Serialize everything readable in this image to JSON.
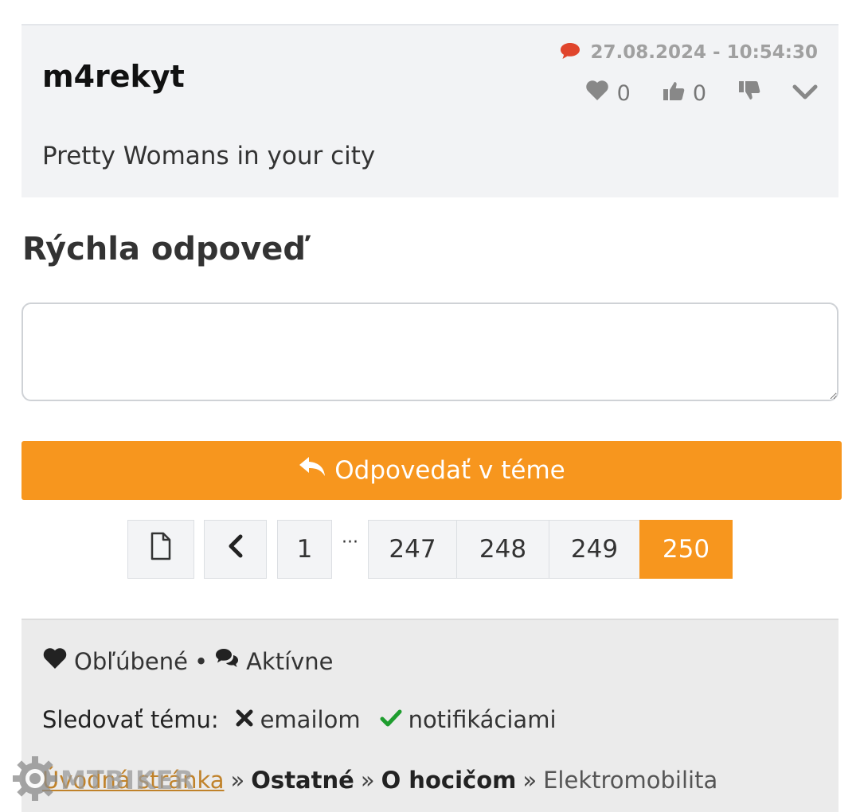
{
  "post": {
    "author": "m4rekyt",
    "date": "27.08.2024 - 10:54:30",
    "likes": "0",
    "thumbs_up": "0",
    "text": "Pretty Womans in your city"
  },
  "quick_reply": {
    "title": "Rýchla odpoveď",
    "placeholder": "",
    "button_label": "Odpovedať v téme"
  },
  "pagination": {
    "pages": [
      "1",
      "247",
      "248",
      "249",
      "250"
    ],
    "ellipsis": "···",
    "active": "250"
  },
  "footer": {
    "favorites_label": "Obľúbené",
    "bullet": "•",
    "active_label": "Aktívne",
    "follow_label": "Sledovať tému:",
    "follow_email": "emailom",
    "follow_notifications": "notifikáciami",
    "breadcrumbs": [
      "Úvodná stránka",
      "Ostatné",
      "O hocičom",
      "Elektromobilita"
    ],
    "breadcrumb_sep": "»"
  },
  "watermark": {
    "text": "MTBIKER"
  },
  "colors": {
    "accent": "#f7961e",
    "comment_icon": "#e0452c",
    "check": "#1e9d2e"
  }
}
